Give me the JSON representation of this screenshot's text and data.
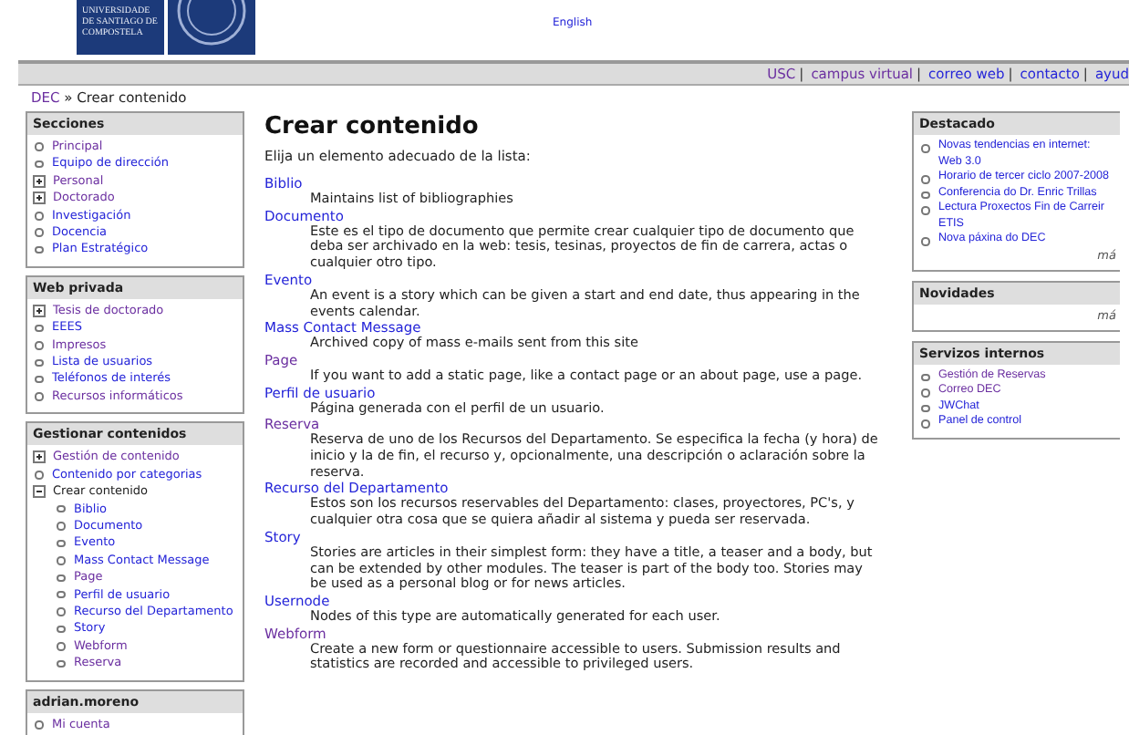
{
  "header": {
    "logo_text": "UNIVERSIDADE DE SANTIAGO DE COMPOSTELA",
    "language_link": {
      "label": "English",
      "visited": false
    }
  },
  "top_links": [
    {
      "label": "USC",
      "visited": true,
      "separator": "|"
    },
    {
      "label": "campus virtual",
      "visited": true,
      "separator": "|"
    },
    {
      "label": "correo web",
      "visited": false,
      "separator": "|"
    },
    {
      "label": "contacto",
      "visited": false,
      "separator": "|"
    },
    {
      "label": "ayud",
      "visited": false
    }
  ],
  "breadcrumb": {
    "link": {
      "label": "DEC",
      "visited": true
    },
    "separator": "»",
    "current": "Crear contenido"
  },
  "left_sidebar": [
    {
      "title": "Secciones",
      "items": [
        {
          "label": "Principal",
          "kind": "leaf",
          "visited": true
        },
        {
          "label": "Equipo de dirección",
          "kind": "leaf",
          "visited": false
        },
        {
          "label": "Personal",
          "kind": "collapsed",
          "visited": true
        },
        {
          "label": "Doctorado",
          "kind": "collapsed",
          "visited": true
        },
        {
          "label": "Investigación",
          "kind": "leaf",
          "visited": false
        },
        {
          "label": "Docencia",
          "kind": "leaf",
          "visited": false
        },
        {
          "label": "Plan Estratégico",
          "kind": "leaf",
          "visited": false
        }
      ]
    },
    {
      "title": "Web privada",
      "items": [
        {
          "label": "Tesis de doctorado",
          "kind": "collapsed",
          "visited": true
        },
        {
          "label": "EEES",
          "kind": "leaf",
          "visited": false
        },
        {
          "label": "Impresos",
          "kind": "leaf",
          "visited": true
        },
        {
          "label": "Lista de usuarios",
          "kind": "leaf",
          "visited": false
        },
        {
          "label": "Teléfonos de interés",
          "kind": "leaf",
          "visited": false
        },
        {
          "label": "Recursos informáticos",
          "kind": "leaf",
          "visited": true
        }
      ]
    },
    {
      "title": "Gestionar contenidos",
      "items": [
        {
          "label": "Gestión de contenido",
          "kind": "collapsed",
          "visited": true,
          "active": false
        },
        {
          "label": "Contenido por categorias",
          "kind": "leaf",
          "visited": false,
          "active": false
        },
        {
          "label": "Crear contenido",
          "kind": "expanded",
          "active": true,
          "children": [
            {
              "label": "Biblio",
              "kind": "leaf",
              "visited": false
            },
            {
              "label": "Documento",
              "kind": "leaf",
              "visited": false
            },
            {
              "label": "Evento",
              "kind": "leaf",
              "visited": false
            },
            {
              "label": "Mass Contact Message",
              "kind": "leaf",
              "visited": false
            },
            {
              "label": "Page",
              "kind": "leaf",
              "visited": true
            },
            {
              "label": "Perfil de usuario",
              "kind": "leaf",
              "visited": false
            },
            {
              "label": "Recurso del Departamento",
              "kind": "leaf",
              "visited": false
            },
            {
              "label": "Story",
              "kind": "leaf",
              "visited": false
            },
            {
              "label": "Webform",
              "kind": "leaf",
              "visited": true
            },
            {
              "label": "Reserva",
              "kind": "leaf",
              "visited": true
            }
          ]
        }
      ]
    },
    {
      "title": "adrian.moreno",
      "items": [
        {
          "label": "Mi cuenta",
          "kind": "leaf",
          "visited": true
        }
      ]
    }
  ],
  "main": {
    "title": "Crear contenido",
    "intro": "Elija un elemento adecuado de la lista:",
    "content_types": [
      {
        "name": "Biblio",
        "visited": false,
        "description": "Maintains list of bibliographies"
      },
      {
        "name": "Documento",
        "visited": false,
        "description": "Este es el tipo de documento que permite crear cualquier tipo de documento que deba ser archivado en la web: tesis, tesinas, proyectos de fin de carrera, actas o cualquier otro tipo."
      },
      {
        "name": "Evento",
        "visited": false,
        "description": "An event is a story which can be given a start and end date, thus appearing in the events calendar."
      },
      {
        "name": "Mass Contact Message",
        "visited": false,
        "description": "Archived copy of mass e-mails sent from this site"
      },
      {
        "name": "Page",
        "visited": true,
        "description": "If you want to add a static page, like a contact page or an about page, use a page."
      },
      {
        "name": "Perfil de usuario",
        "visited": false,
        "description": "Página generada con el perfil de un usuario."
      },
      {
        "name": "Reserva",
        "visited": true,
        "description": "Reserva de uno de los Recursos del Departamento. Se especifica la fecha (y hora) de inicio y la de fin, el recurso y, opcionalmente, una descripción o aclaración sobre la reserva."
      },
      {
        "name": "Recurso del Departamento",
        "visited": false,
        "description": "Estos son los recursos reservables del Departamento: clases, proyectores, PC's, y cualquier otra cosa que se quiera añadir al sistema y pueda ser reservada."
      },
      {
        "name": "Story",
        "visited": false,
        "description": "Stories are articles in their simplest form: they have a title, a teaser and a body, but can be extended by other modules. The teaser is part of the body too. Stories may be used as a personal blog or for news articles."
      },
      {
        "name": "Usernode",
        "visited": false,
        "description": "Nodes of this type are automatically generated for each user."
      },
      {
        "name": "Webform",
        "visited": true,
        "description": "Create a new form or questionnaire accessible to users. Submission results and statistics are recorded and accessible to privileged users."
      }
    ]
  },
  "right_sidebar": [
    {
      "title": "Destacado",
      "items": [
        {
          "label": "Novas tendencias en internet: Web 3.0",
          "visited": false
        },
        {
          "label": "Horario de tercer ciclo 2007-2008",
          "visited": false
        },
        {
          "label": "Conferencia do Dr. Enric Trillas",
          "visited": false
        },
        {
          "label": "Lectura Proxectos Fin de Carreir ETIS",
          "visited": false
        },
        {
          "label": "Nova páxina do DEC",
          "visited": false
        }
      ],
      "more": "má"
    },
    {
      "title": "Novidades",
      "more": "má"
    },
    {
      "title": "Servizos internos",
      "items": [
        {
          "label": "Gestión de Reservas",
          "visited": true
        },
        {
          "label": "Correo DEC",
          "visited": true
        },
        {
          "label": "JWChat",
          "visited": false
        },
        {
          "label": "Panel de control",
          "visited": false
        }
      ]
    }
  ]
}
